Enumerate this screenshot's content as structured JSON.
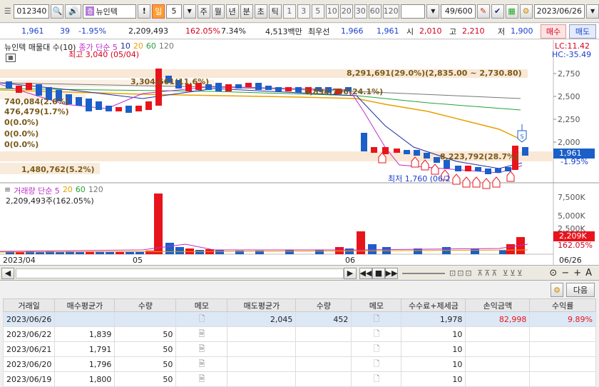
{
  "toolbar": {
    "code": "012340",
    "name": "뉴인텍",
    "period_active": "일",
    "period_count": "5",
    "period_labels": [
      "주",
      "월",
      "년",
      "분",
      "초",
      "틱"
    ],
    "minute_values": [
      "1",
      "3",
      "5",
      "10",
      "20",
      "30",
      "60",
      "120"
    ],
    "page_count": "49",
    "page_total": "/600",
    "date": "2023/06/26"
  },
  "info": {
    "price": "1,961",
    "change": "39",
    "change_pct": "-1.95%",
    "volume": "2,209,493",
    "volume_ratio": "162.05%",
    "turnover": "7.34%",
    "amount": "4,513백만",
    "best_label": "최우선",
    "best_ask": "1,966",
    "best_bid": "1,961",
    "open_label": "시",
    "open": "2,010",
    "high_label": "고",
    "high": "2,210",
    "low_label": "저",
    "low": "1,900",
    "buy_label": "매수",
    "sell_label": "매도"
  },
  "price_chart": {
    "legend_title": "뉴인텍 매물대 수(10)",
    "legend_close": "종가 단순 5",
    "legend_ma": [
      "10",
      "20",
      "60",
      "120"
    ],
    "high_note": "최고 3,040 (05/04)",
    "low_note": "최저 1,760 (06/2",
    "lc": "LC:11.42",
    "hc": "HC:-35.49",
    "price_label": "1,961",
    "pct_label": "-1.95%",
    "y_ticks": [
      "2,750",
      "2,500",
      "2,250",
      "2,000"
    ],
    "profile_labels": [
      "8,291,691(29.0%)(2,835.00 ~ 2,730.80)",
      "3,304,661(11.6%)",
      "6,894,796(24.1%)",
      "740,084(2.6%)",
      "476,479(1.7%)",
      "0(0.0%)",
      "0(0.0%)",
      "0(0.0%)",
      "8,223,792(28.7%)",
      "1,480,762(5.2%)"
    ]
  },
  "volume_chart": {
    "legend_title": "거래량 단순 5",
    "legend_ma": [
      "20",
      "60",
      "120"
    ],
    "volume_note": "2,209,493주(162.05%)",
    "y_ticks": [
      "7,500K",
      "5,000K",
      "2,500K"
    ],
    "vol_label": "2,209K",
    "pct_label": "162.05%"
  },
  "x_axis": [
    "2023/04",
    "05",
    "06",
    "06/26"
  ],
  "table_toolbar": {
    "next_label": "다음"
  },
  "trades": {
    "headers": [
      "거래일",
      "매수평균가",
      "수량",
      "메모",
      "매도평균가",
      "수량",
      "메모",
      "수수료+제세금",
      "손익금액",
      "수익률"
    ],
    "rows": [
      [
        "2023/06/26",
        "",
        "",
        "",
        "2,045",
        "452",
        "",
        "1,978",
        "82,998",
        "9.89%"
      ],
      [
        "2023/06/22",
        "1,839",
        "50",
        "",
        "",
        "",
        "",
        "10",
        "",
        ""
      ],
      [
        "2023/06/21",
        "1,791",
        "50",
        "",
        "",
        "",
        "",
        "10",
        "",
        ""
      ],
      [
        "2023/06/20",
        "1,796",
        "50",
        "",
        "",
        "",
        "",
        "10",
        "",
        ""
      ],
      [
        "2023/06/19",
        "1,800",
        "50",
        "",
        "",
        "",
        "",
        "10",
        "",
        ""
      ]
    ]
  },
  "colors": {
    "up": "#e8141c",
    "down": "#1b5fc9",
    "accent": "#ff9d2e"
  }
}
